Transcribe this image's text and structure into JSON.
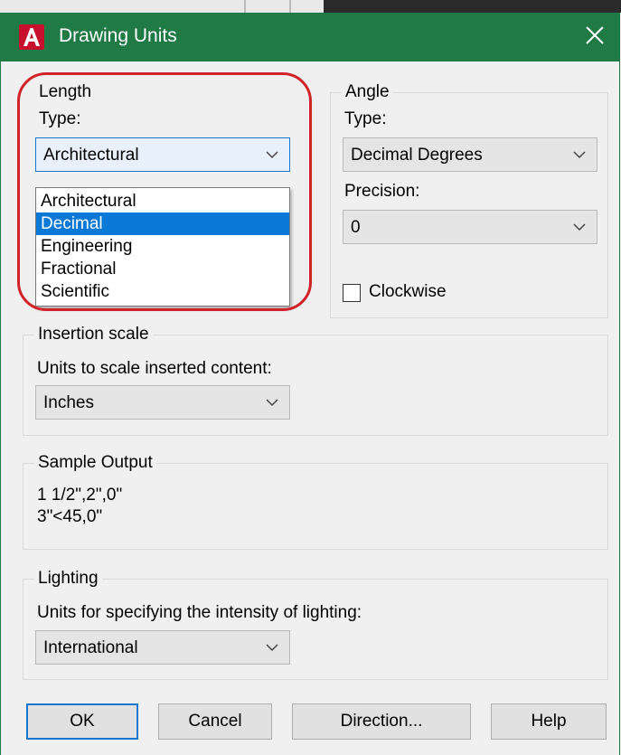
{
  "window": {
    "title": "Drawing Units",
    "accent": "#1f7a45",
    "app_icon": "autocad-a-icon",
    "close_icon": "close-icon"
  },
  "length": {
    "group_label": "Length",
    "type_label": "Type:",
    "type_value": "Architectural",
    "options": [
      "Architectural",
      "Decimal",
      "Engineering",
      "Fractional",
      "Scientific"
    ],
    "highlighted_option": "Decimal"
  },
  "angle": {
    "group_label": "Angle",
    "type_label": "Type:",
    "type_value": "Decimal Degrees",
    "precision_label": "Precision:",
    "precision_value": "0",
    "clockwise_label": "Clockwise",
    "clockwise_checked": false
  },
  "insertion": {
    "group_label": "Insertion scale",
    "label": "Units to scale inserted content:",
    "value": "Inches"
  },
  "sample": {
    "group_label": "Sample Output",
    "line1": "1 1/2\",2\",0\"",
    "line2": "3\"<45,0\""
  },
  "lighting": {
    "group_label": "Lighting",
    "label": "Units for specifying the intensity of lighting:",
    "value": "International"
  },
  "buttons": {
    "ok": "OK",
    "cancel": "Cancel",
    "direction": "Direction...",
    "help": "Help"
  }
}
